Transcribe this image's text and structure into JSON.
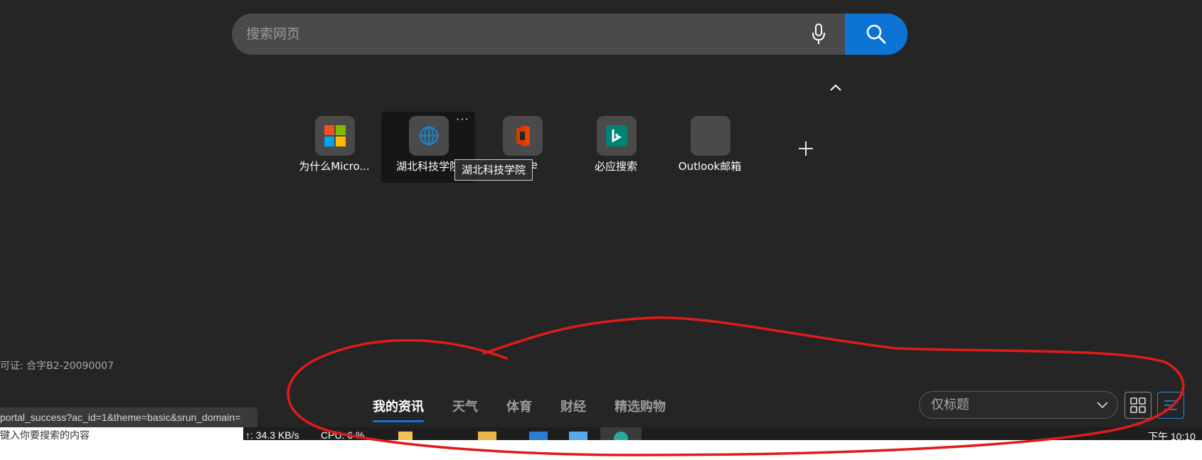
{
  "search": {
    "placeholder": "搜索网页",
    "mic_icon": "microphone-icon",
    "button_icon": "search-icon"
  },
  "quick_links": [
    {
      "label": "为什么Micro...",
      "icon": "microsoft-logo-icon"
    },
    {
      "label": "湖北科技学院",
      "icon": "globe-icon",
      "hovered": true,
      "more": "···"
    },
    {
      "label": "Office",
      "icon": "office-logo-icon"
    },
    {
      "label": "必应搜索",
      "icon": "bing-logo-icon"
    },
    {
      "label": "Outlook邮箱",
      "icon": "outlook-icon"
    }
  ],
  "tooltip": "湖北科技学院",
  "license_text": "可证: 合字B2-20090007",
  "status_url": "portal_success?ac_id=1&theme=basic&srun_domain=",
  "news_tabs": [
    "我的资讯",
    "天气",
    "体育",
    "财经",
    "精选购物"
  ],
  "active_tab": "我的资讯",
  "view_select": {
    "value": "仅标题"
  },
  "taskbar": {
    "left_text": "键入你要搜索的内容",
    "network": "↑: 34.3 KB/s",
    "cpu": "CPU: 6 %",
    "clock": "下午 10:10"
  },
  "colors": {
    "background": "#252525",
    "accent": "#0c74d4",
    "annotation": "#e01b1b"
  }
}
